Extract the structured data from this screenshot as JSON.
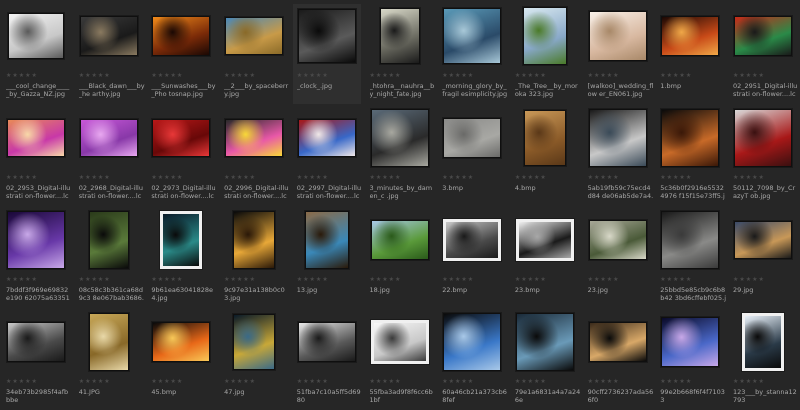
{
  "rating_glyph": "★★★★★",
  "thumbnails": [
    {
      "name": "___cool_change_____by_Gazza_NZ.jpg",
      "w": 56,
      "h": 46,
      "colors": [
        "#f2f2f2",
        "#c8c8c8",
        "#5a5a5a"
      ],
      "sel": false,
      "white": false
    },
    {
      "name": "___Black_dawn___by_he arthy.jpg",
      "w": 58,
      "h": 40,
      "colors": [
        "#3a3a3a",
        "#1a1a1a",
        "#8a7a60"
      ],
      "sel": false,
      "white": false
    },
    {
      "name": "___Sunwashes___by_Pho tosnap.jpg",
      "w": 58,
      "h": 40,
      "colors": [
        "#f08a1a",
        "#7a2a08",
        "#1a0804"
      ],
      "sel": false,
      "white": false
    },
    {
      "name": "__2___by_spaceberry.jpg",
      "w": 58,
      "h": 38,
      "colors": [
        "#4a88b8",
        "#c89a48",
        "#8a6a28"
      ],
      "sel": false,
      "white": false
    },
    {
      "name": "_clock_.jpg",
      "w": 58,
      "h": 54,
      "colors": [
        "#1a1a1a",
        "#5a5a5a",
        "#0a0a0a"
      ],
      "sel": true,
      "white": false
    },
    {
      "name": "_htohra__nauhra__b y_night_fate.jpg",
      "w": 40,
      "h": 56,
      "colors": [
        "#d8d8c8",
        "#6a6a60",
        "#1a1a1a"
      ],
      "sel": false,
      "white": false
    },
    {
      "name": "_morning_glory_by_fragil esimplicity.jpg",
      "w": 58,
      "h": 56,
      "colors": [
        "#5a9ab8",
        "#2a4a68",
        "#a8c8d8"
      ],
      "sel": false,
      "white": false
    },
    {
      "name": "_The_Tree__by_moroka 323.jpg",
      "w": 44,
      "h": 58,
      "colors": [
        "#d8e8f0",
        "#88a8c8",
        "#4a7a28"
      ],
      "sel": false,
      "white": false
    },
    {
      "name": "[walkoo]_wedding_flow er_EN061.jpg",
      "w": 58,
      "h": 50,
      "colors": [
        "#f8f0e8",
        "#d8b8a0",
        "#a88868"
      ],
      "sel": false,
      "white": false
    },
    {
      "name": "1.bmp",
      "w": 58,
      "h": 40,
      "colors": [
        "#1a0804",
        "#c84a18",
        "#f0a848"
      ],
      "sel": false,
      "white": false
    },
    {
      "name": "02_2951_Digital-illustrati on-flower....lcoo.com.jpg",
      "w": 58,
      "h": 40,
      "colors": [
        "#c82a18",
        "#2a8a48",
        "#1a1a1a"
      ],
      "sel": false,
      "white": false
    },
    {
      "name": "02_2953_Digital-illustrati on-flower....lcoo.com.jpg",
      "w": 58,
      "h": 38,
      "colors": [
        "#e88a58",
        "#c838a8",
        "#f8d8a8"
      ],
      "sel": false,
      "white": false
    },
    {
      "name": "02_2968_Digital-illustrati on-flower....lcoo.com.jpg",
      "w": 58,
      "h": 38,
      "colors": [
        "#c858d8",
        "#8838a8",
        "#e8a8f0"
      ],
      "sel": false,
      "white": false
    },
    {
      "name": "02_2973_Digital-illustrati on-flower....lcoo.com.jpg",
      "w": 58,
      "h": 38,
      "colors": [
        "#b81818",
        "#680808",
        "#e83838"
      ],
      "sel": false,
      "white": false
    },
    {
      "name": "02_2996_Digital-illustrati on-flower....lcoo.com.jpg",
      "w": 58,
      "h": 38,
      "colors": [
        "#2a2a2a",
        "#e858a8",
        "#f8d838"
      ],
      "sel": false,
      "white": false
    },
    {
      "name": "02_2997_Digital-illustrati on-flower....lcoo.com.jpg",
      "w": 58,
      "h": 38,
      "colors": [
        "#a81818",
        "#3868c8",
        "#f0e8e8"
      ],
      "sel": false,
      "white": false
    },
    {
      "name": "3_minutes_by_damen_c .jpg",
      "w": 58,
      "h": 58,
      "colors": [
        "#5a6a78",
        "#2a2a2a",
        "#a8a8a0"
      ],
      "sel": false,
      "white": false
    },
    {
      "name": "3.bmp",
      "w": 58,
      "h": 40,
      "colors": [
        "#8a8a88",
        "#a8a8a4",
        "#6a6a68"
      ],
      "sel": false,
      "white": false
    },
    {
      "name": "4.bmp",
      "w": 42,
      "h": 56,
      "colors": [
        "#c89858",
        "#8a5a28",
        "#5a3818"
      ],
      "sel": false,
      "white": false
    },
    {
      "name": "5ab19fb59c75ecd4d84 de06ab5de7a4.jpg",
      "w": 58,
      "h": 58,
      "colors": [
        "#1a1a1a",
        "#c8c8c8",
        "#3a4a58"
      ],
      "sel": false,
      "white": false
    },
    {
      "name": "5c36b0f2916e55324976 f15f15e73ff5.jpg",
      "w": 58,
      "h": 58,
      "colors": [
        "#0a0a0a",
        "#c86a28",
        "#3a1808"
      ],
      "sel": false,
      "white": false
    },
    {
      "name": "50112_7098_by_CrazyT ob.jpg",
      "w": 58,
      "h": 58,
      "colors": [
        "#d8d8d8",
        "#a81818",
        "#3a1010"
      ],
      "sel": false,
      "white": false
    },
    {
      "name": "7bddf3f969e69832e190 62075a633513.jpg",
      "w": 58,
      "h": 58,
      "colors": [
        "#1a0838",
        "#6838a8",
        "#c8a8e8"
      ],
      "sel": false,
      "white": false
    },
    {
      "name": "08c58c3b361ca68d9c3 8e067bab3686.jpg",
      "w": 40,
      "h": 58,
      "colors": [
        "#2a3a1a",
        "#5a7a3a",
        "#0a0a0a"
      ],
      "sel": false,
      "white": false
    },
    {
      "name": "9b61ea63041828e4.jpg",
      "w": 42,
      "h": 58,
      "colors": [
        "#0a1a28",
        "#2a8a88",
        "#0a0a0a"
      ],
      "sel": false,
      "white": true
    },
    {
      "name": "9c97e31a138b0c03.jpg",
      "w": 42,
      "h": 58,
      "colors": [
        "#0a0a0a",
        "#e8a838",
        "#2a1808"
      ],
      "sel": false,
      "white": false
    },
    {
      "name": "13.jpg",
      "w": 44,
      "h": 58,
      "colors": [
        "#8a6a48",
        "#3a88b8",
        "#2a1a0a"
      ],
      "sel": false,
      "white": false
    },
    {
      "name": "18.jpg",
      "w": 58,
      "h": 40,
      "colors": [
        "#a8c8e8",
        "#5a9a3a",
        "#2a5a1a"
      ],
      "sel": false,
      "white": false
    },
    {
      "name": "22.bmp",
      "w": 58,
      "h": 42,
      "colors": [
        "#c8c8c8",
        "#4a4a4a",
        "#1a1a1a"
      ],
      "sel": false,
      "white": true
    },
    {
      "name": "23.bmp",
      "w": 58,
      "h": 42,
      "colors": [
        "#f0f0f0",
        "#1a1a1a",
        "#a8a8a8"
      ],
      "sel": false,
      "white": true
    },
    {
      "name": "23.jpg",
      "w": 58,
      "h": 40,
      "colors": [
        "#a8a898",
        "#4a5a38",
        "#d8d8c8"
      ],
      "sel": false,
      "white": false
    },
    {
      "name": "25bbd5e85cb9c6b8b42 3bd6cffebf025.jpg",
      "w": 58,
      "h": 58,
      "colors": [
        "#1a1a1a",
        "#8a8a88",
        "#3a3a3a"
      ],
      "sel": false,
      "white": false
    },
    {
      "name": "29.jpg",
      "w": 58,
      "h": 38,
      "colors": [
        "#3a4a68",
        "#c89858",
        "#1a1a1a"
      ],
      "sel": false,
      "white": false
    },
    {
      "name": "34eb73b2985f4afbbbe",
      "w": 58,
      "h": 40,
      "colors": [
        "#c8c8c8",
        "#4a4a4a",
        "#1a1a1a"
      ],
      "sel": false,
      "white": false
    },
    {
      "name": "41.JPG",
      "w": 40,
      "h": 58,
      "colors": [
        "#c8a858",
        "#886828",
        "#e8d8a8"
      ],
      "sel": false,
      "white": false
    },
    {
      "name": "45.bmp",
      "w": 58,
      "h": 40,
      "colors": [
        "#0a0a0a",
        "#e86818",
        "#f8c858"
      ],
      "sel": false,
      "white": false
    },
    {
      "name": "47.jpg",
      "w": 42,
      "h": 56,
      "colors": [
        "#0a1a28",
        "#c8a838",
        "#3a6a88"
      ],
      "sel": false,
      "white": false
    },
    {
      "name": "51fba7c10a5ff5d6980",
      "w": 58,
      "h": 40,
      "colors": [
        "#e8e8e8",
        "#5a5a5a",
        "#1a1a1a"
      ],
      "sel": false,
      "white": false
    },
    {
      "name": "55fba3ad9f8f6cc6b1bf",
      "w": 58,
      "h": 44,
      "colors": [
        "#f8f8f8",
        "#c8c8c8",
        "#3a3a3a"
      ],
      "sel": false,
      "white": true
    },
    {
      "name": "60a46cb21a373cb68fef",
      "w": 58,
      "h": 58,
      "colors": [
        "#0a0a0a",
        "#3a78c8",
        "#a8c8e8"
      ],
      "sel": false,
      "white": false
    },
    {
      "name": "79e1a6831a4a7a246e",
      "w": 58,
      "h": 58,
      "colors": [
        "#1a2a38",
        "#6a9ab8",
        "#0a0a0a"
      ],
      "sel": false,
      "white": false
    },
    {
      "name": "90cff2736237ada566f0",
      "w": 58,
      "h": 40,
      "colors": [
        "#3a2a1a",
        "#d8a868",
        "#0a0a0a"
      ],
      "sel": false,
      "white": false
    },
    {
      "name": "99e2b668f6f4f71033",
      "w": 58,
      "h": 50,
      "colors": [
        "#0a0a28",
        "#4a68c8",
        "#c8a8e8"
      ],
      "sel": false,
      "white": false
    },
    {
      "name": "123___by_stanna12793",
      "w": 42,
      "h": 58,
      "colors": [
        "#e8f0f8",
        "#2a3a48",
        "#0a0a0a"
      ],
      "sel": false,
      "white": true
    }
  ]
}
